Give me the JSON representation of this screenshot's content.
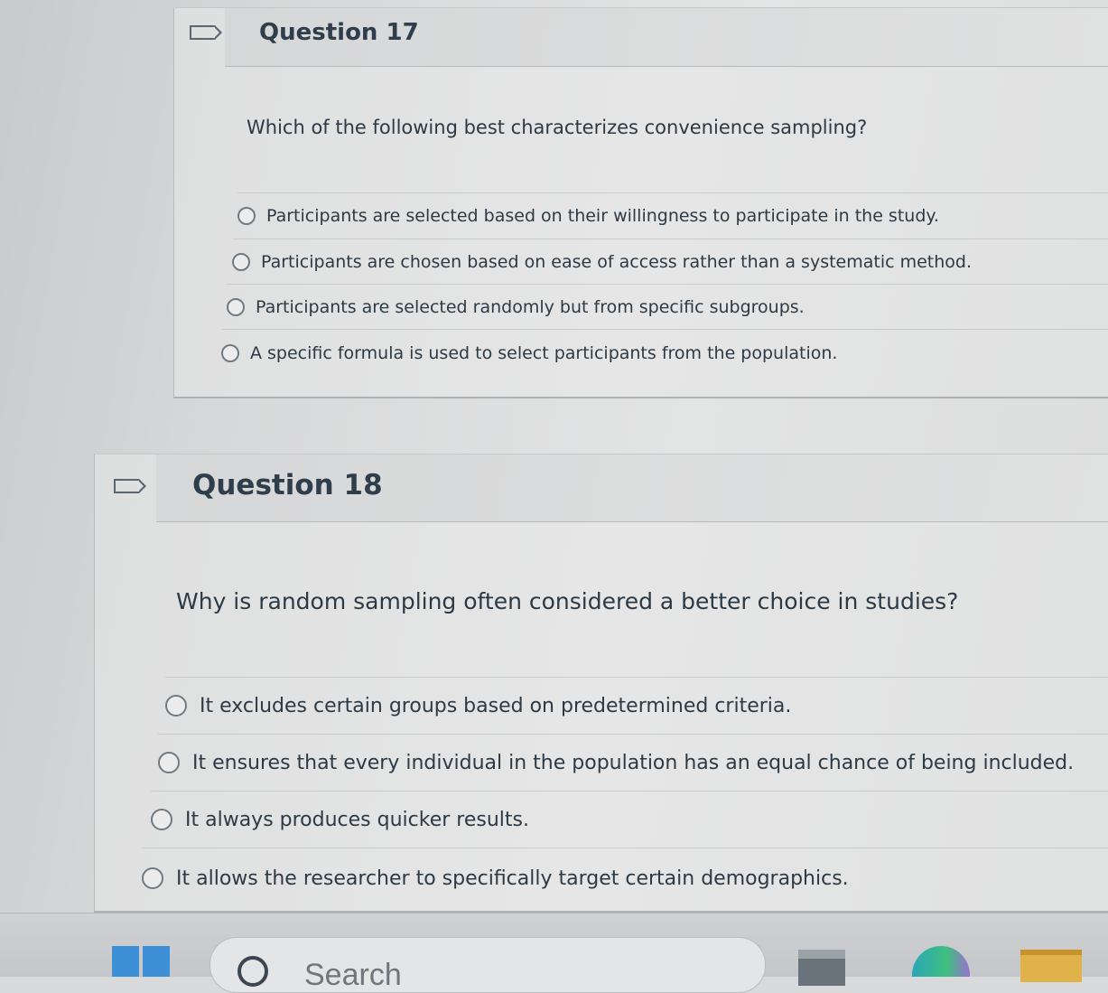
{
  "questions": [
    {
      "title": "Question 17",
      "prompt": "Which of the following best characterizes convenience sampling?",
      "answers": [
        "Participants are selected based on their willingness to participate in the study.",
        "Participants are chosen based on ease of access rather than a systematic method.",
        "Participants are selected randomly but from specific subgroups.",
        "A specific formula is used to select participants from the population."
      ]
    },
    {
      "title": "Question 18",
      "prompt": "Why is random sampling often considered a better choice in studies?",
      "answers": [
        "It excludes certain groups based on predetermined criteria.",
        "It ensures that every individual in the population has an equal chance of being included.",
        "It always produces quicker results.",
        "It allows the researcher to specifically target certain demographics."
      ]
    }
  ],
  "taskbar": {
    "search_label": "Search"
  },
  "icons": {
    "flag": "flag-icon",
    "radio": "radio-button-icon",
    "start": "windows-start-icon",
    "search": "search-icon"
  }
}
